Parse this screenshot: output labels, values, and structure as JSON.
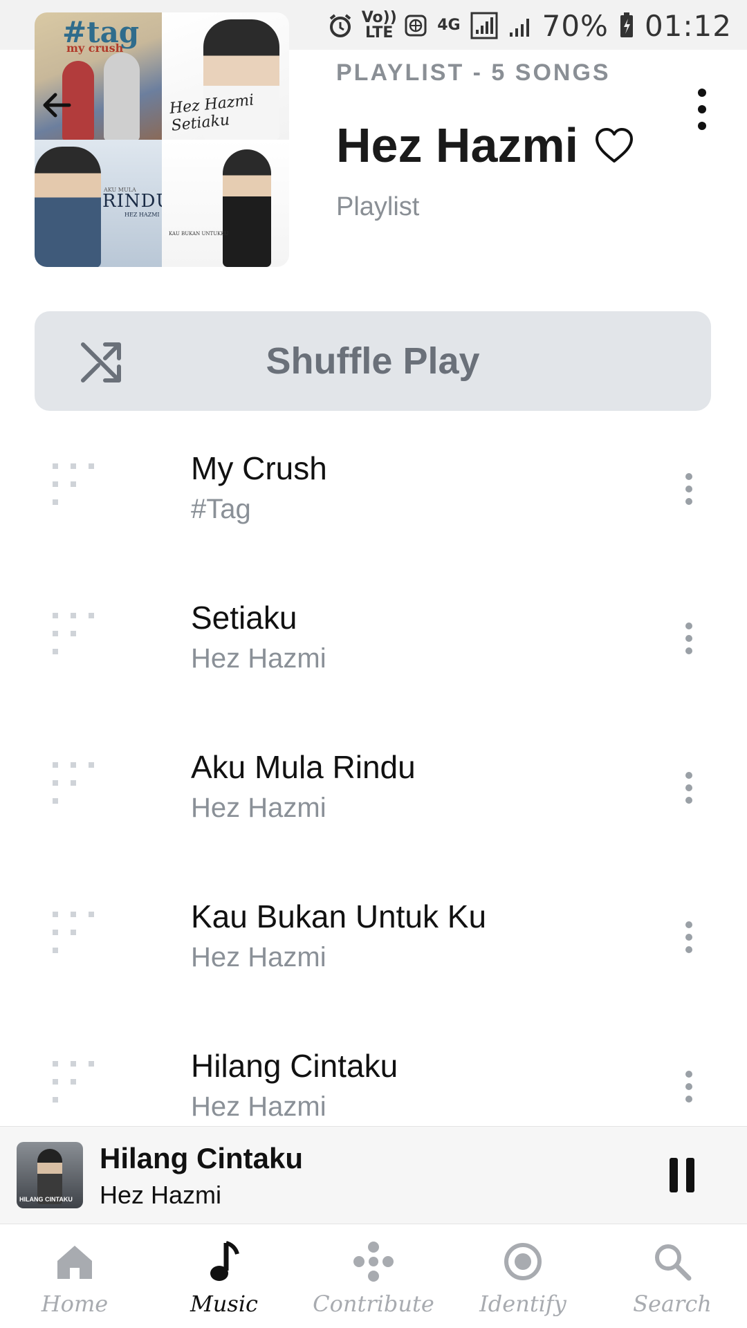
{
  "status_bar": {
    "network_lte": "Vo)) LTE",
    "network_4g": "4G",
    "battery": "70%",
    "time": "01:12"
  },
  "header": {
    "subtitle": "PLAYLIST - 5 SONGS",
    "title": "Hez Hazmi",
    "type": "Playlist",
    "art_tiles": {
      "tile1_line1": "#tag",
      "tile1_line2": "my crush",
      "tile2_text": "Hez Hazmi Setiaku",
      "tile3_small": "AKU MULA",
      "tile3_text": "RINDU",
      "tile3_artist": "HEZ HAZMI",
      "tile4_text": "KAU BUKAN UNTUKKU"
    }
  },
  "shuffle": {
    "label": "Shuffle Play"
  },
  "songs": [
    {
      "title": "My Crush",
      "artist": "#Tag"
    },
    {
      "title": "Setiaku",
      "artist": "Hez Hazmi"
    },
    {
      "title": "Aku Mula Rindu",
      "artist": "Hez Hazmi"
    },
    {
      "title": "Kau Bukan Untuk Ku",
      "artist": "Hez Hazmi"
    },
    {
      "title": "Hilang Cintaku",
      "artist": "Hez Hazmi"
    }
  ],
  "now_playing": {
    "title": "Hilang Cintaku",
    "artist": "Hez Hazmi",
    "art_label": "HILANG CINTAKU"
  },
  "nav": [
    {
      "label": "Home",
      "icon": "home-icon",
      "active": false
    },
    {
      "label": "Music",
      "icon": "music-note-icon",
      "active": true
    },
    {
      "label": "Contribute",
      "icon": "contribute-icon",
      "active": false
    },
    {
      "label": "Identify",
      "icon": "identify-icon",
      "active": false
    },
    {
      "label": "Search",
      "icon": "search-icon",
      "active": false
    }
  ],
  "colors": {
    "accent_text": "#111111",
    "muted_text": "#8a9097",
    "shuffle_bg": "#e2e5e9",
    "inactive_nav": "#a8abb0"
  }
}
